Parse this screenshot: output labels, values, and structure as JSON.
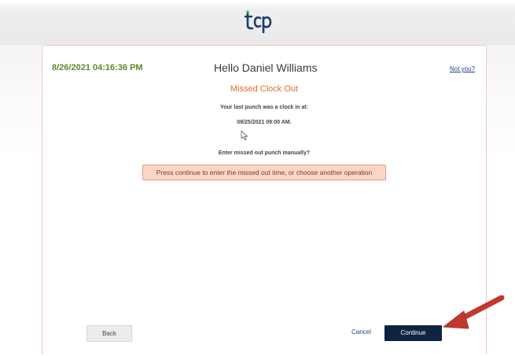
{
  "header": {
    "logo_text": "tcp"
  },
  "session": {
    "datetime": "8/26/2021 04:16:36 PM",
    "greeting": "Hello Daniel Williams",
    "not_you_label": "Not you?"
  },
  "content": {
    "subtitle": "Missed Clock Out",
    "last_punch_label": "Your last punch was a clock in at:",
    "last_punch_value": "08/25/2021 09:00 AM.",
    "prompt": "Enter missed out punch manually?",
    "message": "Press continue to enter the missed out time, or choose another operation"
  },
  "actions": {
    "back_label": "Back",
    "cancel_label": "Cancel",
    "continue_label": "Continue"
  },
  "colors": {
    "accent_orange": "#e46a2b",
    "datetime_green": "#5a8a2a",
    "continue_navy": "#0f2341",
    "message_bg": "#fbd6c5",
    "annotation_arrow": "#c0392b"
  },
  "icons": {
    "logo": "tcp-logo",
    "cursor": "mouse-pointer-icon",
    "annotation": "red-arrow-icon"
  }
}
